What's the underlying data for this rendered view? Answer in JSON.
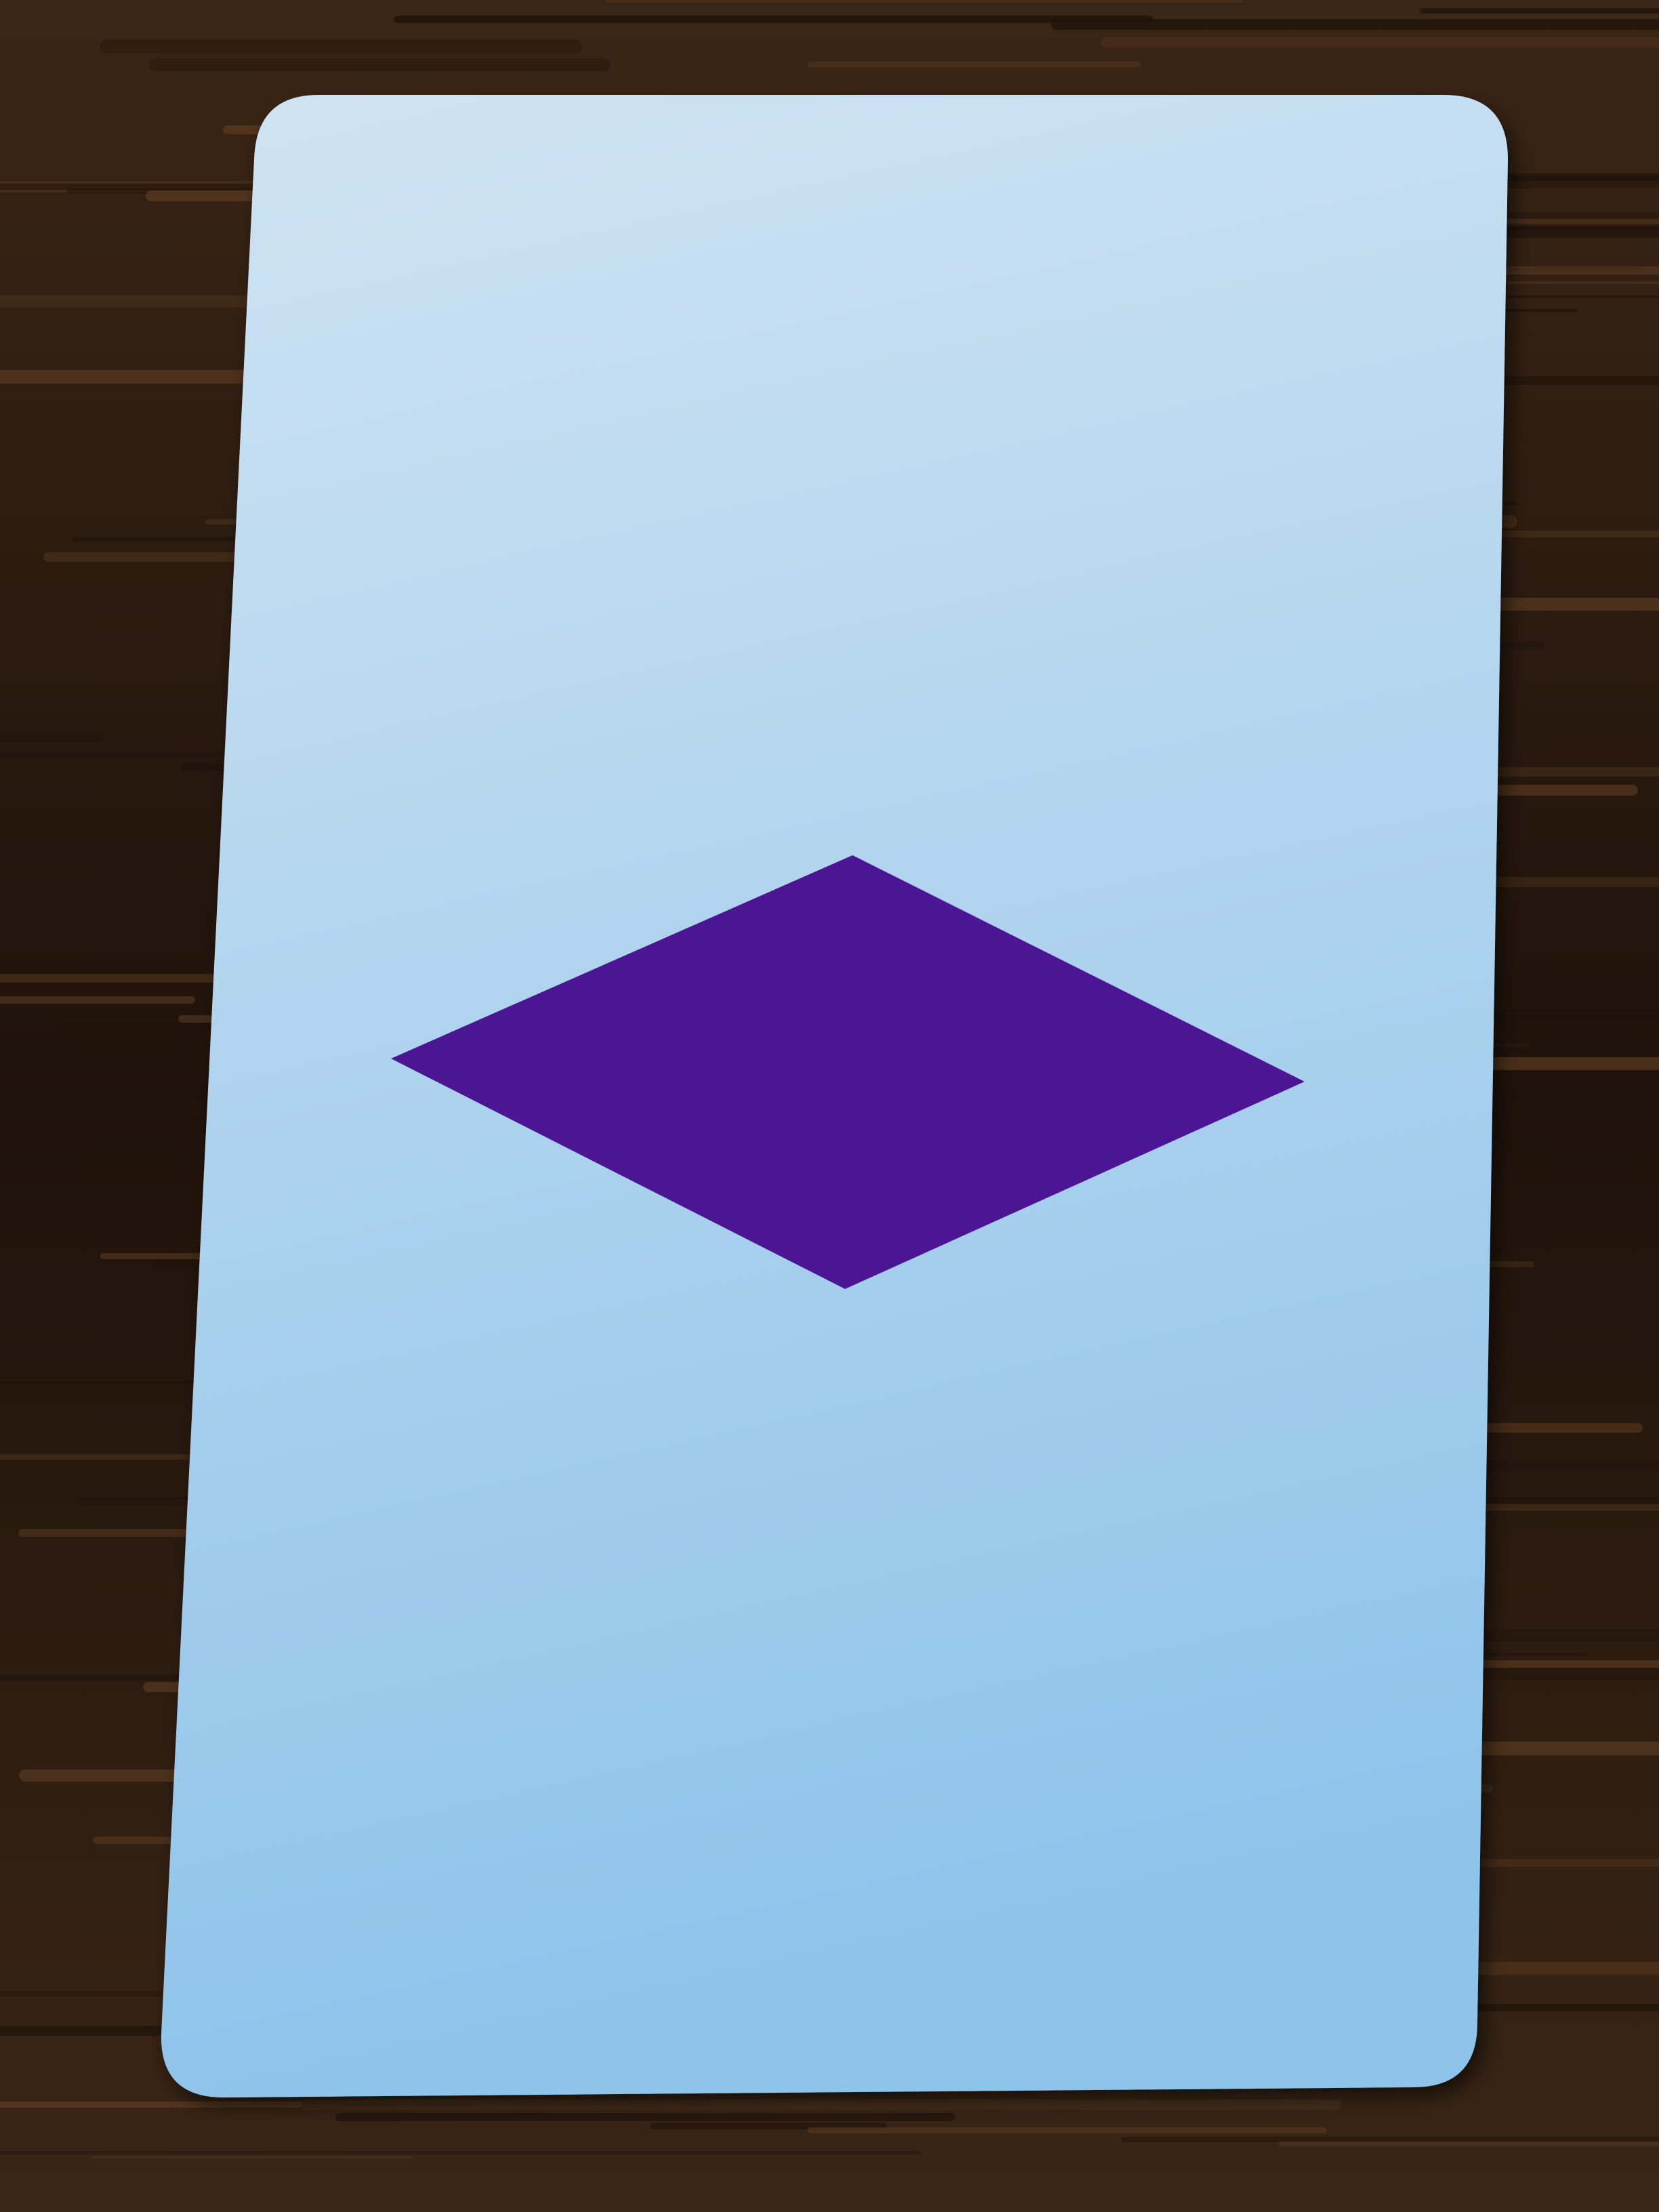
{
  "scene": {
    "surface": "wooden-table",
    "object": "playing-card",
    "symbol": {
      "shape": "diamond",
      "count": 1
    }
  },
  "colors": {
    "wood_dark": "#1f120a",
    "wood_mid": "#3a2616",
    "wood_light": "#5a3b22",
    "card_top": "#cfe3f2",
    "card_bottom": "#8ec3ea",
    "diamond": "#4b1594"
  }
}
